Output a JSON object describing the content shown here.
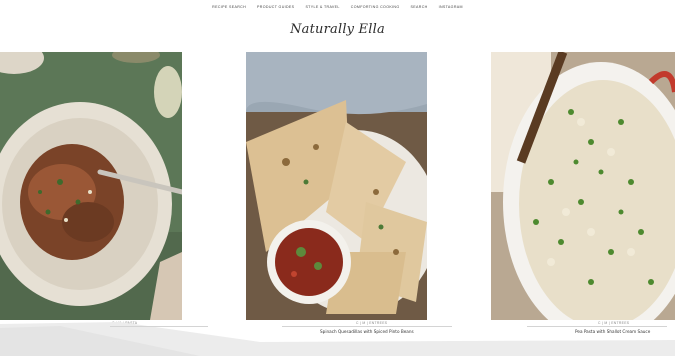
{
  "nav": {
    "items": [
      {
        "label": "RECIPE SEARCH"
      },
      {
        "label": "PRODUCT GUIDES"
      },
      {
        "label": "STYLE & TRAVEL"
      },
      {
        "label": "COMFORTING COOKING"
      },
      {
        "label": "SEARCH"
      },
      {
        "label": "INSTAGRAM"
      }
    ]
  },
  "logo": {
    "text": "Naturally Ella"
  },
  "cards": [
    {
      "category": "C | M | PASTA",
      "title": ""
    },
    {
      "category": "C | M | ENTREES",
      "title": "Spinach Quesadillas with Spiced Pinto Beans"
    },
    {
      "category": "C | M | ENTREES",
      "title": "Pea Pasta with Shallot Cream Sauce"
    }
  ],
  "colors": {
    "green_bg": "#5a7556",
    "plate": "#d8d2c6",
    "tortilla": "#e2c89e",
    "pasta": "#e7dcc0",
    "pea": "#4d8a2f",
    "pot_red": "#c23a2c"
  }
}
